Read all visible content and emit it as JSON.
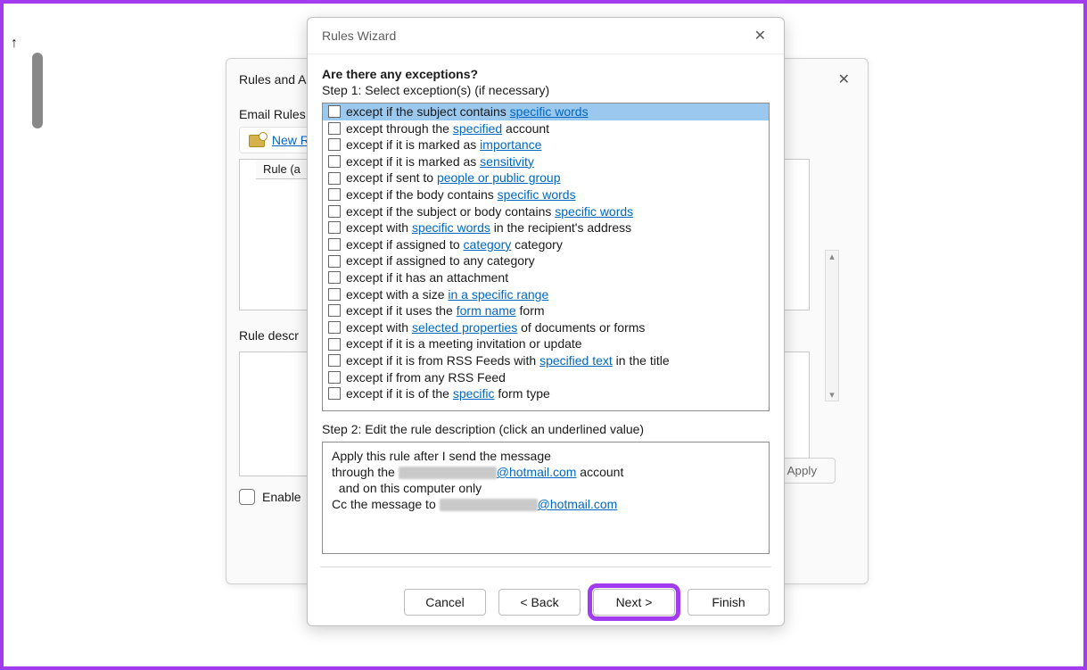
{
  "back_dialog": {
    "title": "Rules and A",
    "email_rules_label": "Email Rules",
    "new_rule_label": "New R",
    "rule_header": "Rule (a",
    "rule_desc_label": "Rule descr",
    "enable_label": "Enable",
    "apply_label": "Apply"
  },
  "wizard": {
    "title": "Rules Wizard",
    "question": "Are there any exceptions?",
    "step1_label": "Step 1: Select exception(s) (if necessary)",
    "step2_label": "Step 2: Edit the rule description (click an underlined value)",
    "exceptions": [
      {
        "pre": "except if the subject contains ",
        "link": "specific words",
        "post": "",
        "selected": true
      },
      {
        "pre": "except through the ",
        "link": "specified",
        "post": " account"
      },
      {
        "pre": "except if it is marked as ",
        "link": "importance",
        "post": ""
      },
      {
        "pre": "except if it is marked as ",
        "link": "sensitivity",
        "post": ""
      },
      {
        "pre": "except if sent to ",
        "link": "people or public group",
        "post": ""
      },
      {
        "pre": "except if the body contains ",
        "link": "specific words",
        "post": ""
      },
      {
        "pre": "except if the subject or body contains ",
        "link": "specific words",
        "post": ""
      },
      {
        "pre": "except with ",
        "link": "specific words",
        "post": " in the recipient's address"
      },
      {
        "pre": "except if assigned to ",
        "link": "category",
        "post": " category"
      },
      {
        "pre": "except if assigned to any category",
        "link": "",
        "post": ""
      },
      {
        "pre": "except if it has an attachment",
        "link": "",
        "post": ""
      },
      {
        "pre": "except with a size ",
        "link": "in a specific range",
        "post": ""
      },
      {
        "pre": "except if it uses the ",
        "link": "form name",
        "post": " form"
      },
      {
        "pre": "except with ",
        "link": "selected properties",
        "post": " of documents or forms"
      },
      {
        "pre": "except if it is a meeting invitation or update",
        "link": "",
        "post": ""
      },
      {
        "pre": "except if it is from RSS Feeds with ",
        "link": "specified text",
        "post": " in the title"
      },
      {
        "pre": "except if from any RSS Feed",
        "link": "",
        "post": ""
      },
      {
        "pre": "except if it is of the ",
        "link": "specific",
        "post": " form type"
      }
    ],
    "desc": {
      "line1": "Apply this rule after I send the message",
      "line2_pre": "through the ",
      "line2_link": "@hotmail.com",
      "line2_post": " account",
      "line3": "  and on this computer only",
      "line4_pre": "Cc the message to ",
      "line4_link": "@hotmail.com"
    },
    "buttons": {
      "cancel": "Cancel",
      "back": "< Back",
      "next": "Next >",
      "finish": "Finish"
    }
  }
}
